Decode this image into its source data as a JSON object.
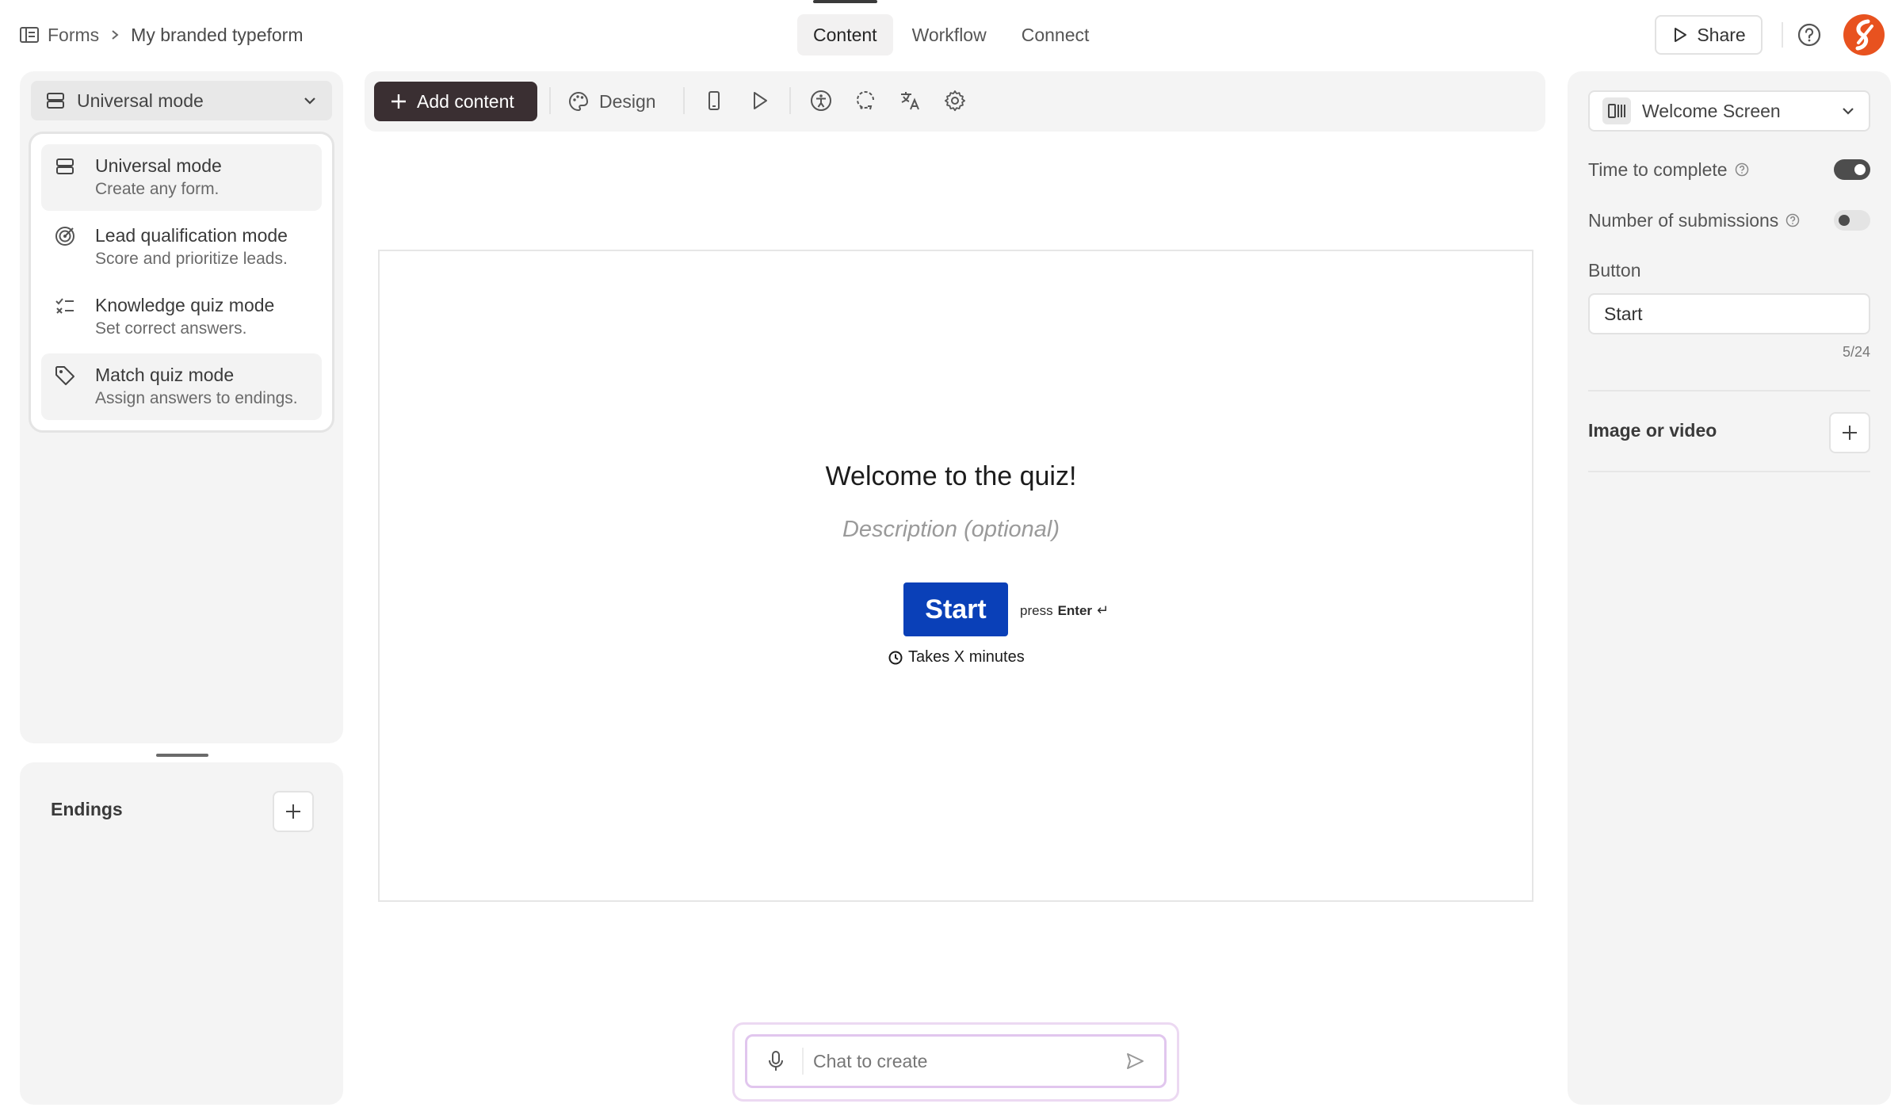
{
  "header": {
    "breadcrumb_root": "Forms",
    "breadcrumb_title": "My branded typeform",
    "tabs": [
      {
        "label": "Content",
        "active": true
      },
      {
        "label": "Workflow",
        "active": false
      },
      {
        "label": "Connect",
        "active": false
      }
    ],
    "share_label": "Share"
  },
  "left": {
    "mode_select_label": "Universal mode",
    "modes": [
      {
        "title": "Universal mode",
        "subtitle": "Create any form.",
        "icon": "rows-icon"
      },
      {
        "title": "Lead qualification mode",
        "subtitle": "Score and prioritize leads.",
        "icon": "target-icon"
      },
      {
        "title": "Knowledge quiz mode",
        "subtitle": "Set correct answers.",
        "icon": "checklist-icon"
      },
      {
        "title": "Match quiz mode",
        "subtitle": "Assign answers to endings.",
        "icon": "tag-icon"
      }
    ],
    "endings_label": "Endings"
  },
  "toolbar": {
    "add_content_label": "Add content",
    "design_label": "Design"
  },
  "canvas": {
    "title": "Welcome to the quiz!",
    "description_placeholder": "Description (optional)",
    "start_label": "Start",
    "press_text": "press",
    "enter_text": "Enter",
    "enter_symbol": "↵",
    "takes_text": "Takes X minutes"
  },
  "chat": {
    "placeholder": "Chat to create"
  },
  "right": {
    "screen_select_label": "Welcome Screen",
    "time_to_complete_label": "Time to complete",
    "time_to_complete_on": true,
    "submissions_label": "Number of submissions",
    "submissions_on": false,
    "button_label": "Button",
    "button_value": "Start",
    "button_counter": "5/24",
    "media_label": "Image or video"
  },
  "colors": {
    "accent": "#0a40b8",
    "add_button": "#3a2f32",
    "logo": "#e8521f",
    "chat_border": "#e1c6ee"
  }
}
